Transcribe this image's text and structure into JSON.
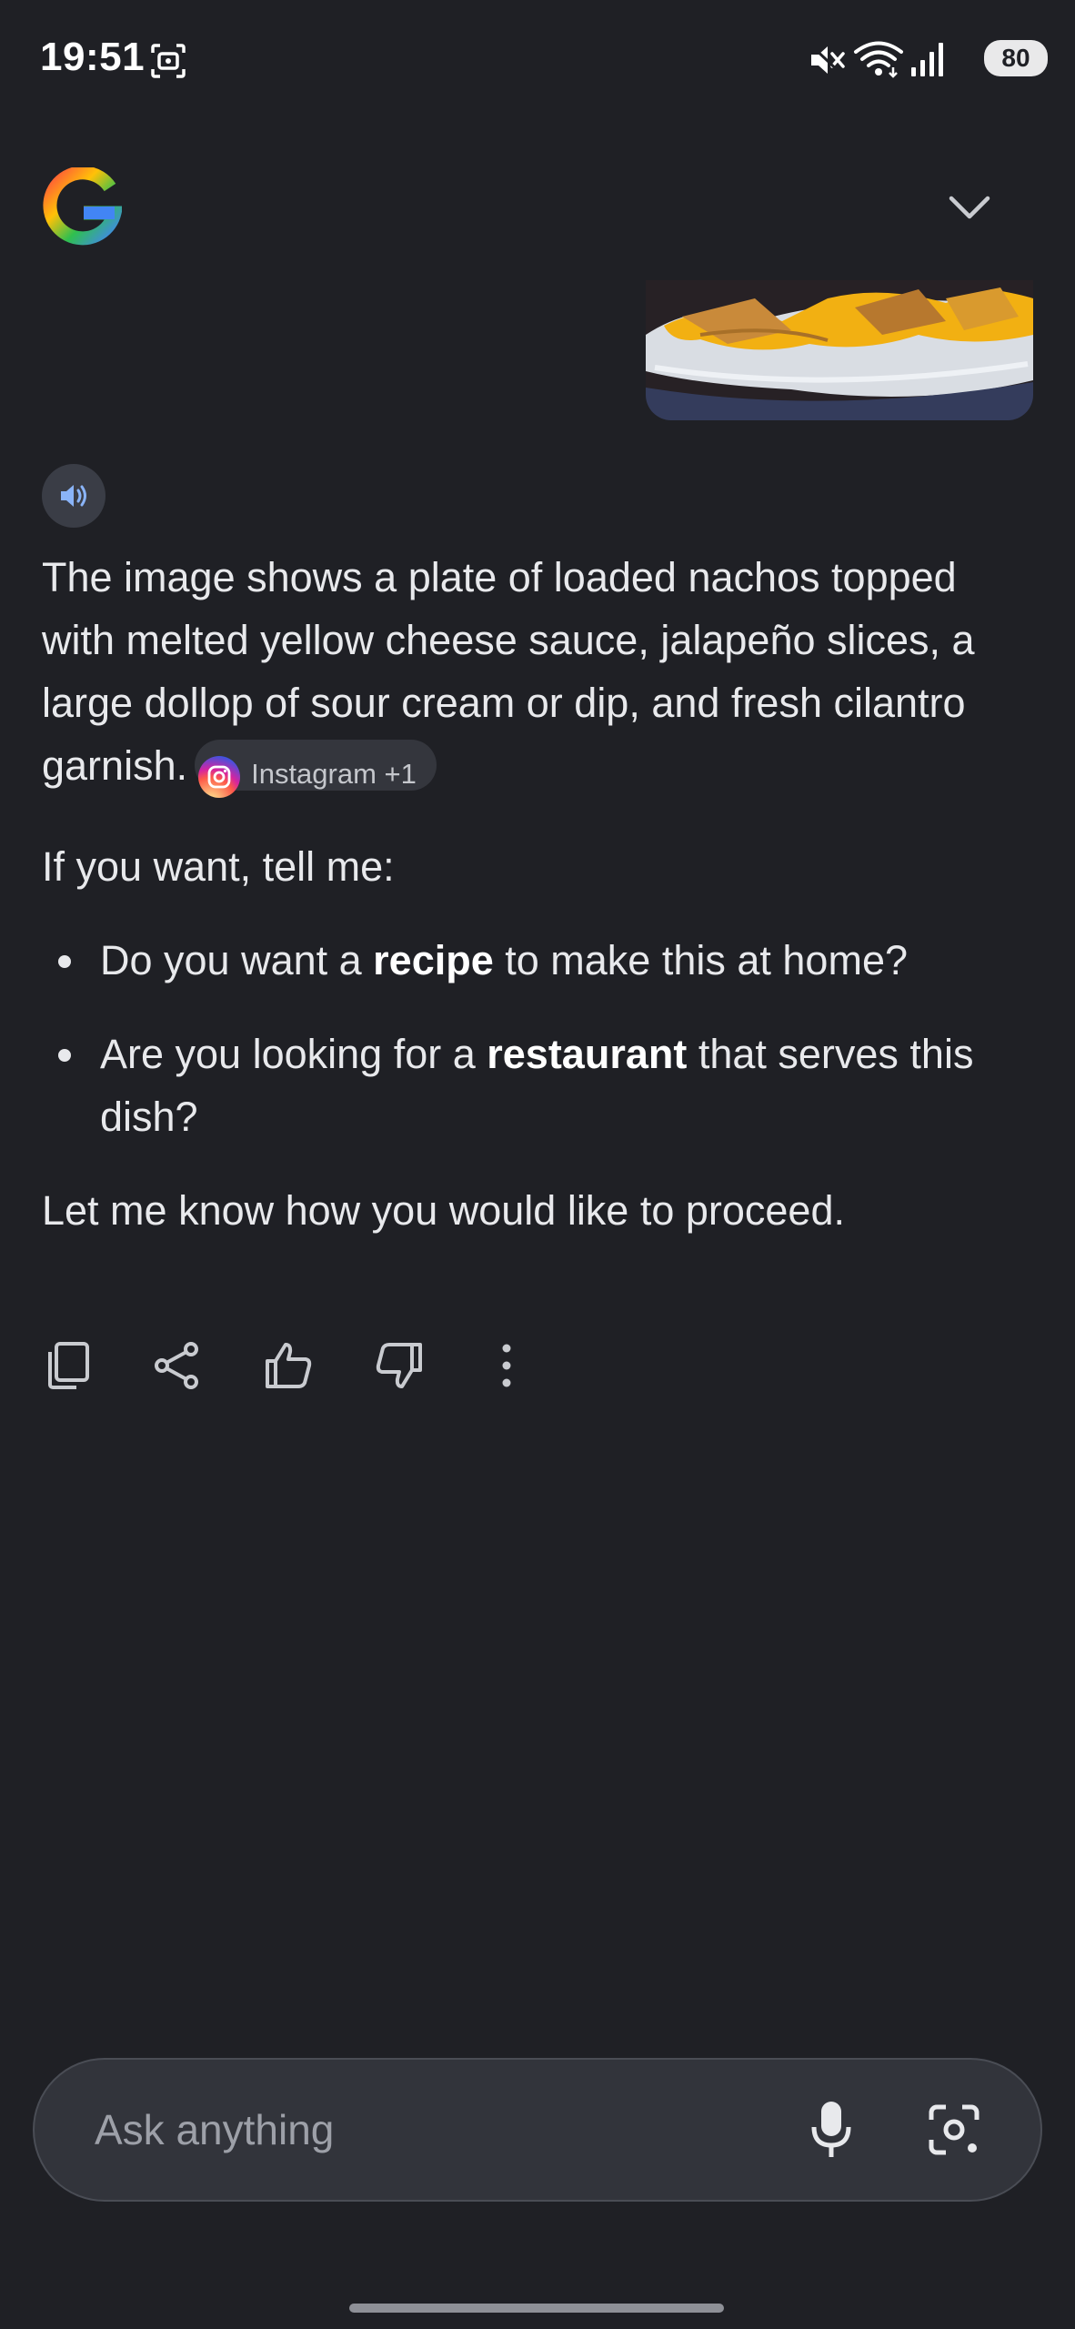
{
  "status_bar": {
    "time": "19:51",
    "battery": "80",
    "icons": [
      "screenshot-icon",
      "mute-icon",
      "wifi-icon",
      "signal-icon"
    ]
  },
  "header": {
    "logo": "google-g-logo",
    "collapse_icon": "chevron-down-icon"
  },
  "colors": {
    "background": "#1f2025",
    "text": "#e8e9ec",
    "input_bg": "#32343b",
    "chip_bg": "#34363d",
    "speaker_accent": "#8ab4f8"
  },
  "response": {
    "paragraph1": "The image shows a plate of loaded nachos topped with melted yellow cheese sauce, jalapeño slices, a large dollop of sour cream or dip, and fresh cilantro garnish.",
    "source_chip": "Instagram +1",
    "paragraph2": "If you want, tell me:",
    "bullets": [
      {
        "before": "Do you want a ",
        "bold": "recipe",
        "after": " to make this at home?"
      },
      {
        "before": "Are you looking for a ",
        "bold": "restaurant",
        "after": " that serves this dish?"
      }
    ],
    "paragraph3": "Let me know how you would like to proceed."
  },
  "actions": [
    "copy-icon",
    "share-icon",
    "thumbs-up-icon",
    "thumbs-down-icon",
    "more-vert-icon"
  ],
  "input": {
    "placeholder": "Ask anything",
    "icons": [
      "mic-icon",
      "lens-icon"
    ]
  }
}
